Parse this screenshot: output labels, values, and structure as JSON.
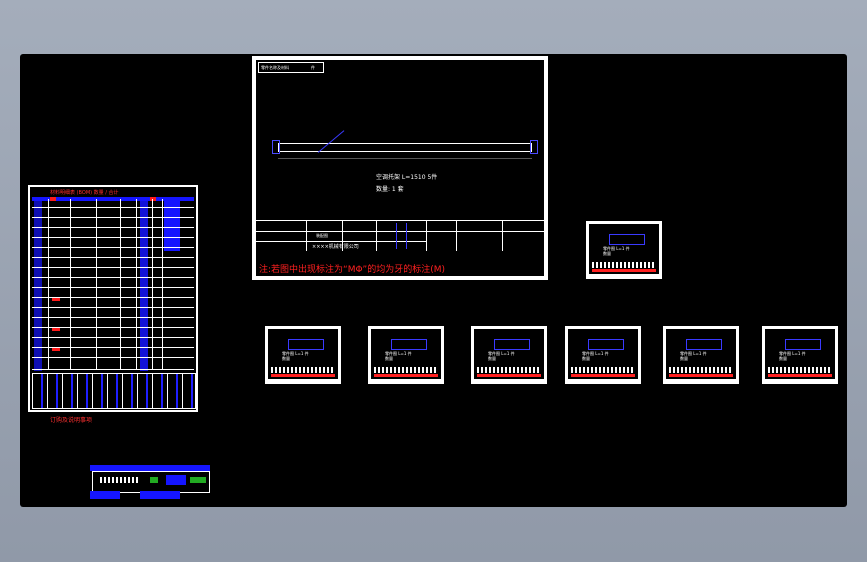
{
  "main_drawing": {
    "header_label": "零件名称及材料",
    "header_sub": "件",
    "spec_line": "空调托架 L=1510 5件",
    "qty_line": "数量: 1 套",
    "company": "××××机械有限公司",
    "title_block_name": "装配图",
    "note": "注:若图中出现标注为“MΦ”的均为牙的标注(M)"
  },
  "thumb_text": {
    "line1": "零件图 L=1 件",
    "line2": "数量"
  },
  "bom": {
    "title": "材料明细表 (BOM) 数量 / 合计",
    "caption": "订购及说明事项"
  },
  "colors": {
    "background": "#000000",
    "line": "#ffffff",
    "accent_blue": "#1515ff",
    "accent_red": "#ff2020"
  }
}
